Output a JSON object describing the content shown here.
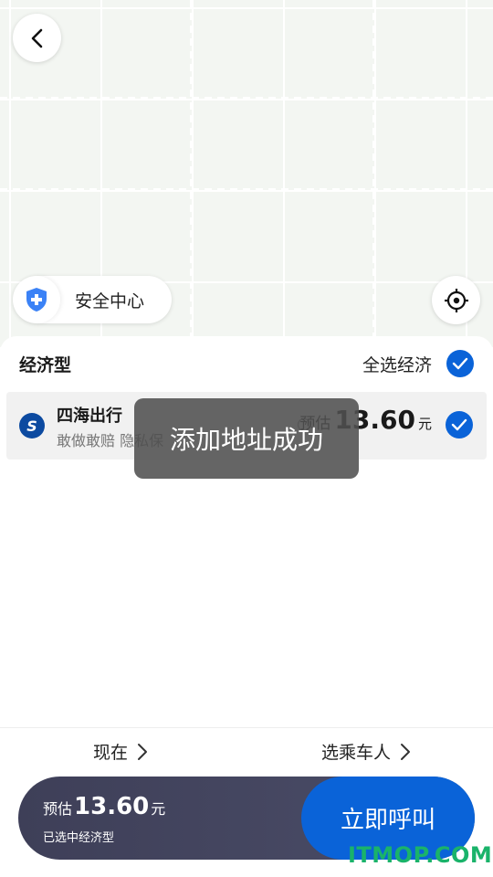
{
  "map": {
    "safety_center": "安全中心"
  },
  "category": {
    "title": "经济型",
    "select_all": "全选经济"
  },
  "provider": {
    "logo_letter": "S",
    "name": "四海出行",
    "tagline": "敢做敢赔 隐私保",
    "price_prefix": "预估",
    "price": "13.60",
    "price_unit": "元"
  },
  "toast": {
    "message": "添加地址成功"
  },
  "options": {
    "time": "现在",
    "passenger": "选乘车人"
  },
  "call_bar": {
    "price_prefix": "预估",
    "price": "13.60",
    "price_unit": "元",
    "selection": "已选中经济型",
    "call_button": "立即呼叫"
  },
  "watermark": "ITMOP.COM",
  "colors": {
    "accent": "#0a63d8",
    "bar_dark": "#3e3f58",
    "watermark": "#1ab36a"
  }
}
